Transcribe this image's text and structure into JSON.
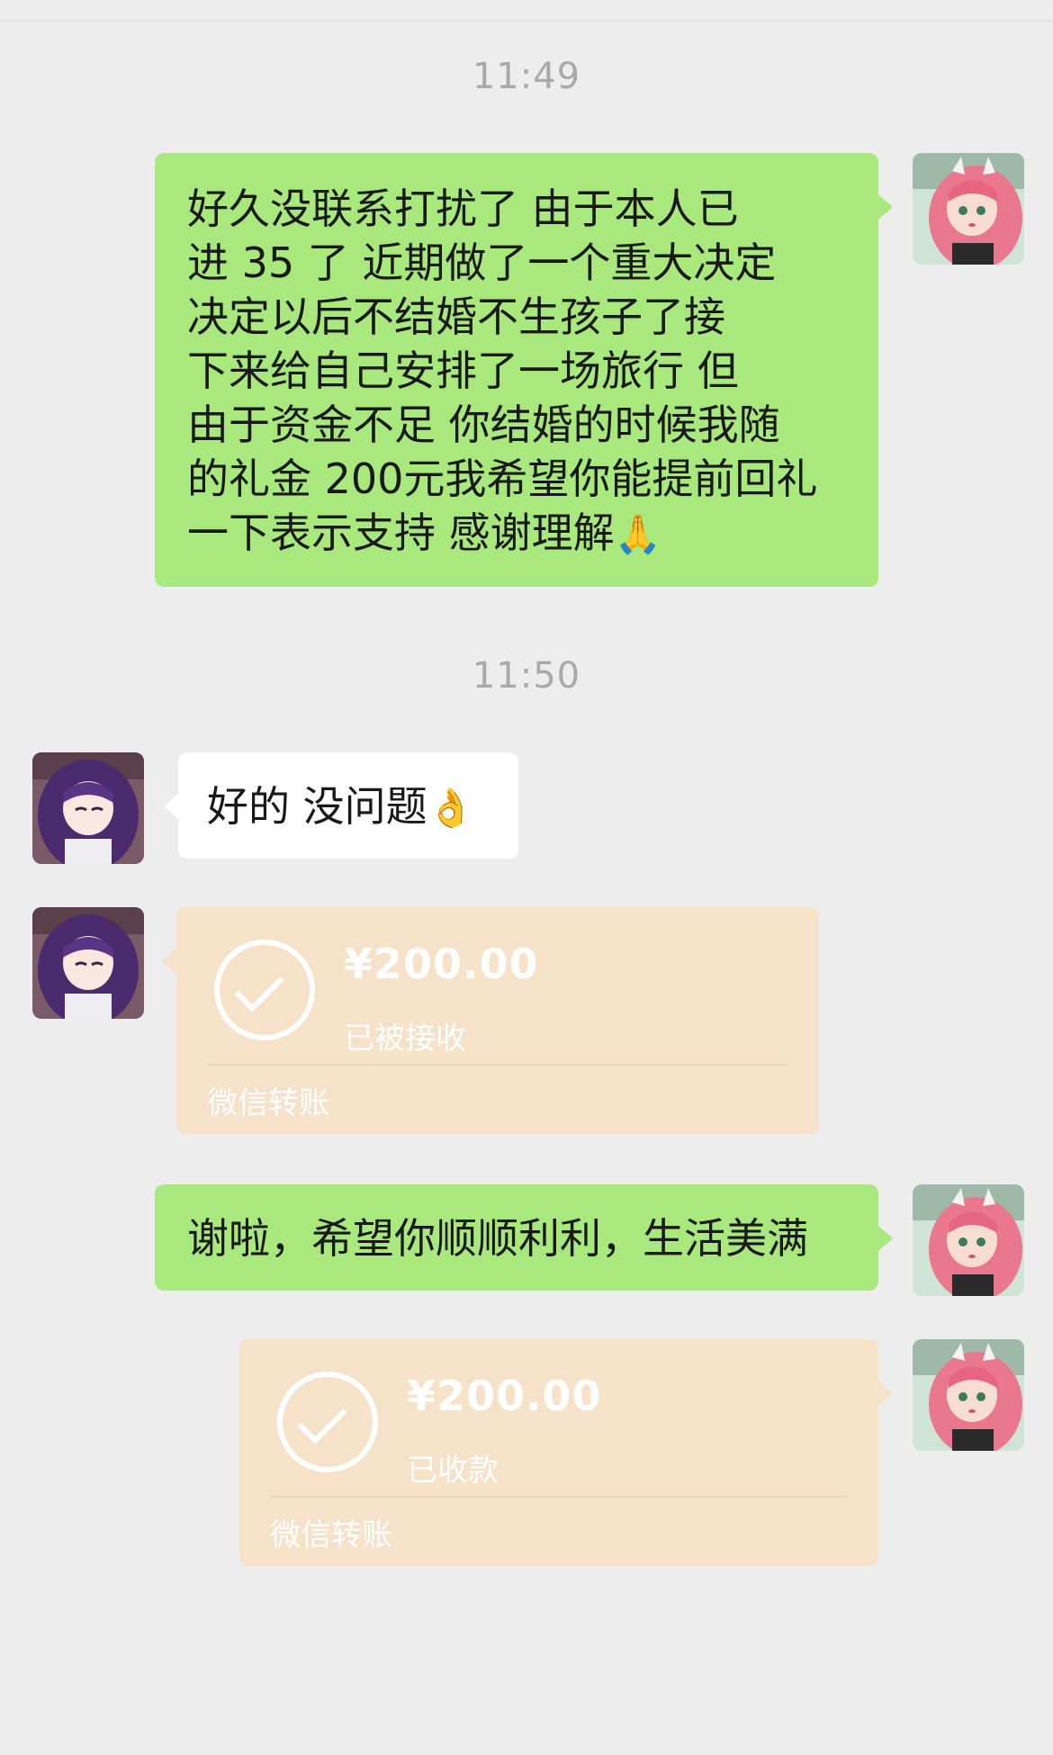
{
  "colors": {
    "background": "#ededed",
    "outgoing_bubble": "#a9e87c",
    "incoming_bubble": "#ffffff",
    "transfer_card": "#f6e1c9",
    "timestamp_text": "#a9a9a9"
  },
  "timestamps": {
    "first": "11:49",
    "second": "11:50"
  },
  "messages": [
    {
      "direction": "outgoing",
      "lines": [
        "好久没联系打扰了 由于本人已",
        "进 35 了 近期做了一个重大决定",
        "决定以后不结婚不生孩子了接",
        "下来给自己安排了一场旅行 但",
        "由于资金不足 你结婚的时候我随",
        "的礼金 200元我希望你能提前回礼",
        "一下表示支持 感谢理解"
      ],
      "emoji": "🙏"
    },
    {
      "direction": "incoming",
      "text": "好的 没问题",
      "emoji": "👌"
    },
    {
      "direction": "incoming",
      "type": "transfer",
      "amount": "¥200.00",
      "status": "已被接收",
      "label": "微信转账"
    },
    {
      "direction": "outgoing",
      "text": "谢啦，希望你顺顺利利，生活美满"
    },
    {
      "direction": "outgoing",
      "type": "transfer",
      "amount": "¥200.00",
      "status": "已收款",
      "label": "微信转账"
    }
  ]
}
